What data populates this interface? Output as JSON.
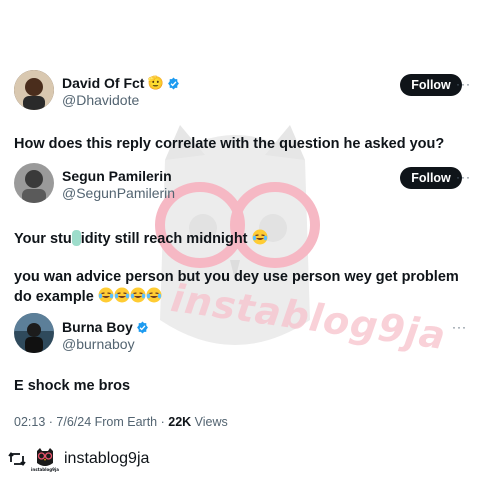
{
  "tweet1": {
    "author_name": "David Of Fct",
    "author_emoji": "🫡",
    "author_handle": "@Dhavidote",
    "follow_label": "Follow",
    "more_label": "···",
    "text": "How does this reply correlate with the question he asked you?"
  },
  "tweet2": {
    "author_name": "Segun Pamilerin",
    "author_handle": "@SegunPamilerin",
    "follow_label": "Follow",
    "more_label": "···",
    "line1_a": "Your stu",
    "line1_b": "idity still reach midnight",
    "line2": "you wan advice person but you dey use person wey get problem do example"
  },
  "tweet3": {
    "author_name": "Burna Boy",
    "author_handle": "@burnaboy",
    "more_label": "···",
    "text": "E shock me bros",
    "meta_time": "02:13 · 7/6/24 From Earth · ",
    "meta_views_count": "22K",
    "meta_views_label": " Views"
  },
  "footer": {
    "account_name": "instablog9ja",
    "logo_text": "instablog9ja"
  },
  "watermark_text": "instablog9ja",
  "colors": {
    "verified_blue": "#1d9bf0",
    "follow_bg": "#0f1419",
    "watermark_pink": "#f4a3b3",
    "teal_blur": "#7fd1b9"
  }
}
